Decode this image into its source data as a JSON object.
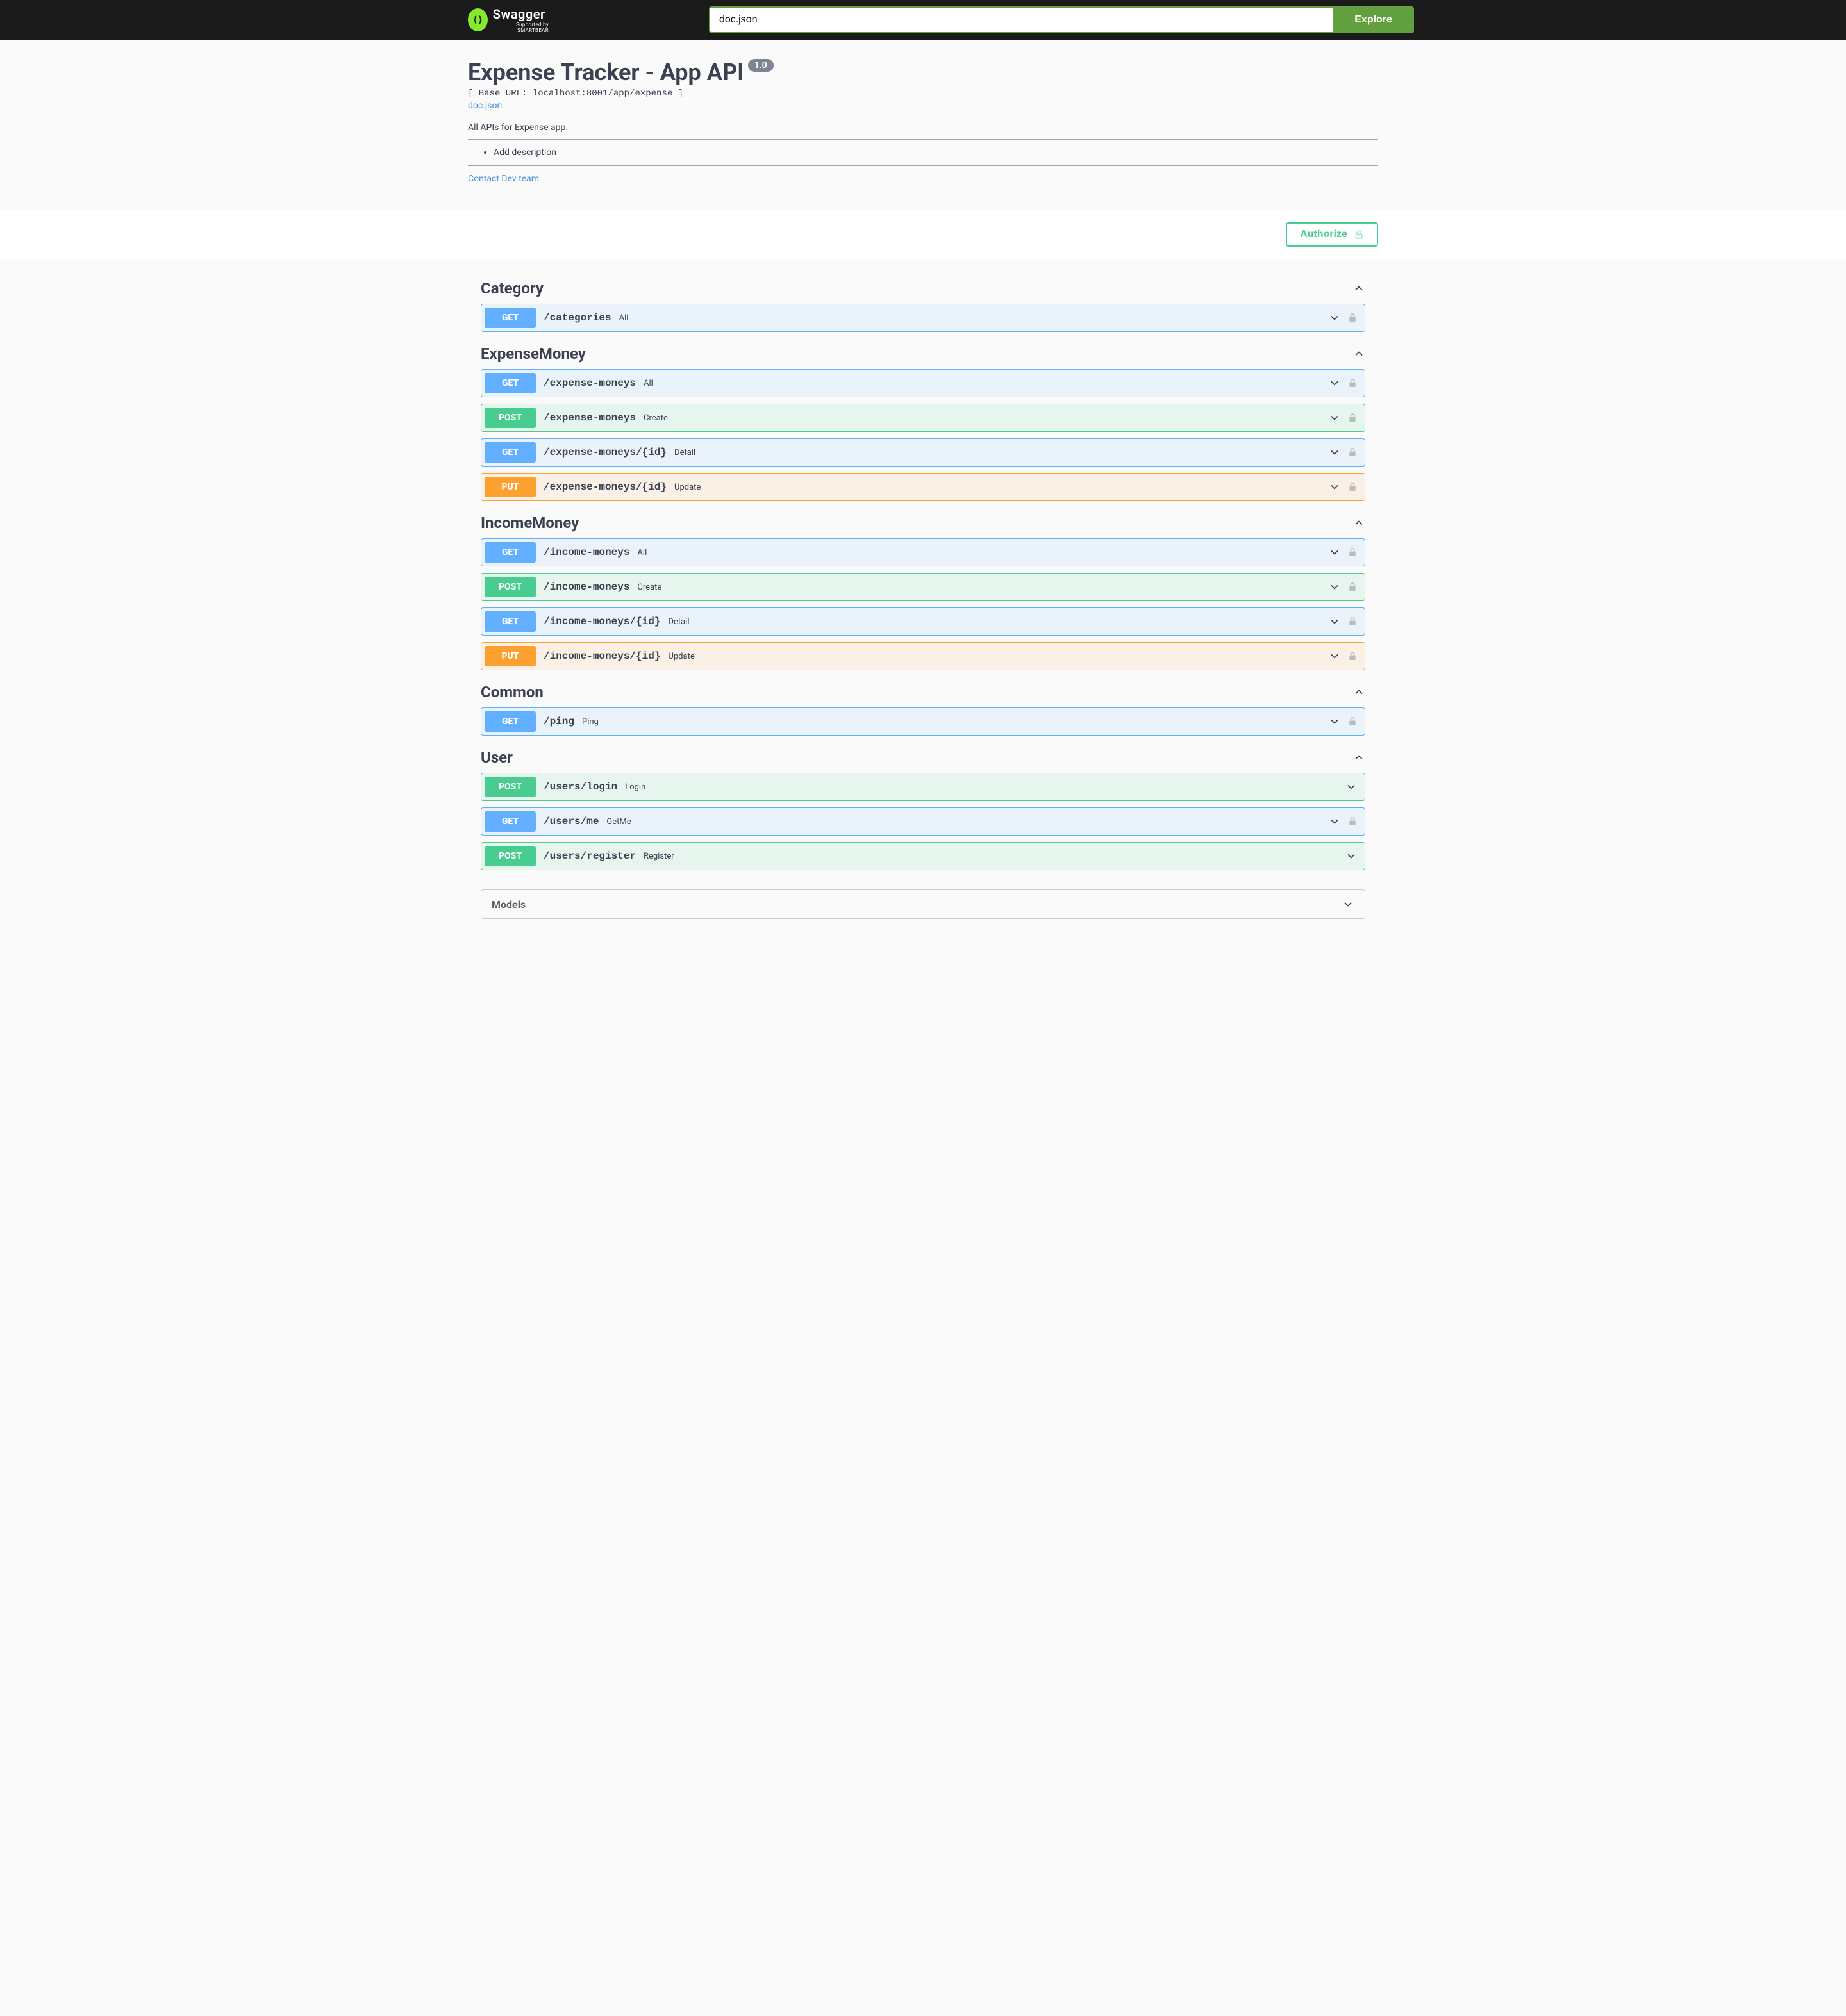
{
  "topbar": {
    "logo_text": "Swagger",
    "logo_sub": "Supported by SMARTBEAR",
    "search_value": "doc.json",
    "explore_label": "Explore"
  },
  "info": {
    "title": "Expense Tracker - App API",
    "version": "1.0",
    "base_url": "[ Base URL: localhost:8001/app/expense ]",
    "doc_link": "doc.json",
    "description": "All APIs for Expense app.",
    "list_item": "Add description",
    "contact": "Contact Dev team"
  },
  "authorize_label": "Authorize",
  "tags": [
    {
      "name": "Category",
      "ops": [
        {
          "method": "GET",
          "path": "/categories",
          "summary": "All",
          "locked": true
        }
      ]
    },
    {
      "name": "ExpenseMoney",
      "ops": [
        {
          "method": "GET",
          "path": "/expense-moneys",
          "summary": "All",
          "locked": true
        },
        {
          "method": "POST",
          "path": "/expense-moneys",
          "summary": "Create",
          "locked": true
        },
        {
          "method": "GET",
          "path": "/expense-moneys/{id}",
          "summary": "Detail",
          "locked": true
        },
        {
          "method": "PUT",
          "path": "/expense-moneys/{id}",
          "summary": "Update",
          "locked": true
        }
      ]
    },
    {
      "name": "IncomeMoney",
      "ops": [
        {
          "method": "GET",
          "path": "/income-moneys",
          "summary": "All",
          "locked": true
        },
        {
          "method": "POST",
          "path": "/income-moneys",
          "summary": "Create",
          "locked": true
        },
        {
          "method": "GET",
          "path": "/income-moneys/{id}",
          "summary": "Detail",
          "locked": true
        },
        {
          "method": "PUT",
          "path": "/income-moneys/{id}",
          "summary": "Update",
          "locked": true
        }
      ]
    },
    {
      "name": "Common",
      "ops": [
        {
          "method": "GET",
          "path": "/ping",
          "summary": "Ping",
          "locked": true
        }
      ]
    },
    {
      "name": "User",
      "ops": [
        {
          "method": "POST",
          "path": "/users/login",
          "summary": "Login",
          "locked": false
        },
        {
          "method": "GET",
          "path": "/users/me",
          "summary": "GetMe",
          "locked": true
        },
        {
          "method": "POST",
          "path": "/users/register",
          "summary": "Register",
          "locked": false
        }
      ]
    }
  ],
  "models_label": "Models"
}
